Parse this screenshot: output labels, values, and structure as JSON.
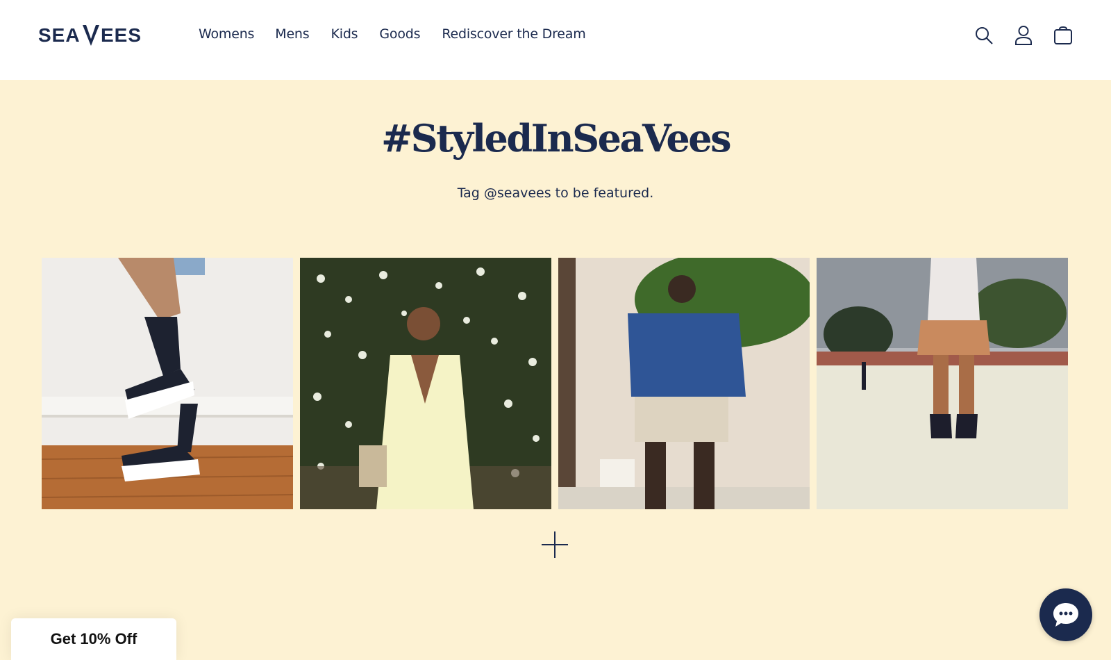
{
  "brand": {
    "logo_text": "SEAVEES",
    "color": "#1b2a4e"
  },
  "nav": {
    "items": [
      {
        "label": "Womens"
      },
      {
        "label": "Mens"
      },
      {
        "label": "Kids"
      },
      {
        "label": "Goods"
      },
      {
        "label": "Rediscover the Dream"
      }
    ]
  },
  "header_icons": [
    "search-icon",
    "account-icon",
    "cart-icon"
  ],
  "section": {
    "title": "#StyledInSeaVees",
    "subtitle": "Tag @seavees to be featured.",
    "background": "#fdf2d3"
  },
  "gallery": {
    "tiles": [
      {
        "alt": "tattooed legs wearing black platform sneakers"
      },
      {
        "alt": "woman in pale yellow dress in front of flowering bush"
      },
      {
        "alt": "man in navy sweater and khaki shorts"
      },
      {
        "alt": "woman sitting on wall wearing black high-top sneakers"
      }
    ],
    "load_more_icon": "plus-icon"
  },
  "promo": {
    "label": "Get 10% Off"
  },
  "chat": {
    "icon": "chat-bubble-icon"
  }
}
